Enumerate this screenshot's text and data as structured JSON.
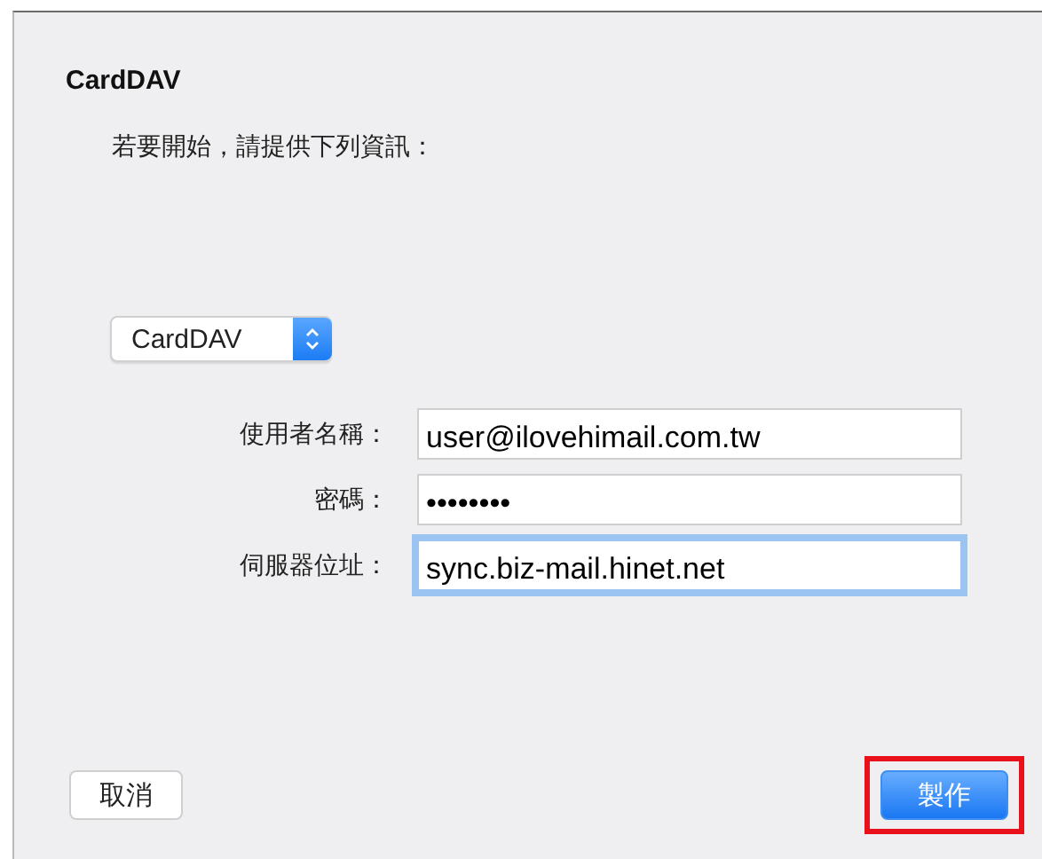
{
  "dialog": {
    "title": "CardDAV",
    "prompt": "若要開始，請提供下列資訊：",
    "account_type": {
      "value": "CardDAV"
    },
    "fields": [
      {
        "label": "使用者名稱：",
        "value": "user@ilovehimail.com.tw",
        "focused": false
      },
      {
        "label": "密碼：",
        "value": "••••••••",
        "focused": false
      },
      {
        "label": "伺服器位址：",
        "value": "sync.biz-mail.hinet.net",
        "focused": true
      }
    ],
    "buttons": [
      {
        "label": "取消",
        "kind": "plain",
        "highlighted": false
      },
      {
        "label": "製作",
        "kind": "default",
        "highlighted": true
      }
    ]
  }
}
